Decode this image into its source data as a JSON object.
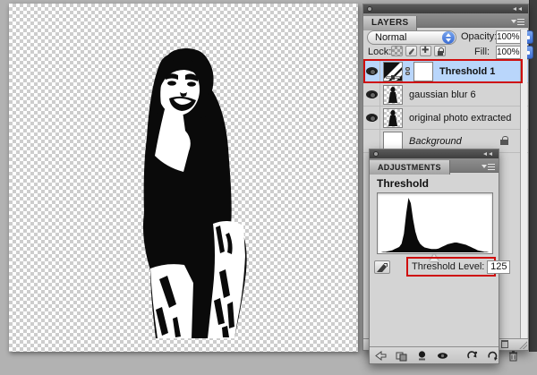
{
  "colors": {
    "background": "#b2b2b2",
    "panel": "#d4d4d4",
    "selected_row": "#b9d6fb",
    "annotation_red": "#cf0e0e",
    "checker_dark": "#cdcdcd",
    "checker_light": "#ffffff"
  },
  "canvas": {
    "description": "black and white threshold silhouette of a girl on transparent checkerboard"
  },
  "layers_panel": {
    "tab": "LAYERS",
    "blend_mode": "Normal",
    "opacity_label": "Opacity:",
    "opacity_value": "100%",
    "lock_label": "Lock:",
    "lock_icons": [
      "lock-transparent-pixels",
      "lock-image-pixels",
      "lock-position",
      "lock-all"
    ],
    "fill_label": "Fill:",
    "fill_value": "100%",
    "layers": [
      {
        "name": "Threshold 1",
        "selected": true,
        "visible": true,
        "type": "threshold-adjustment",
        "red_highlight": true
      },
      {
        "name": "gaussian blur 6",
        "selected": false,
        "visible": true,
        "type": "image"
      },
      {
        "name": "original photo extracted",
        "selected": false,
        "visible": true,
        "type": "image"
      },
      {
        "name": "Background",
        "selected": false,
        "visible": false,
        "type": "background",
        "locked": true
      }
    ]
  },
  "adjustments_panel": {
    "tab": "ADJUSTMENTS",
    "title": "Threshold",
    "threshold_label": "Threshold Level:",
    "threshold_value": "125",
    "slider_position": 0.49,
    "histogram": [
      0,
      0,
      1,
      1,
      2,
      3,
      4,
      6,
      8,
      10,
      16,
      34,
      72,
      100,
      90,
      60,
      38,
      24,
      16,
      12,
      9,
      8,
      7,
      6,
      6,
      6,
      7,
      9,
      11,
      13,
      15,
      16,
      17,
      18,
      18,
      17,
      16,
      15,
      14,
      12,
      10,
      8,
      6,
      4,
      3,
      2,
      1,
      1,
      0,
      0
    ],
    "footer_icons": [
      "return-to-adjustment-list",
      "expanded-view",
      "clip-to-layer",
      "toggle-layer-visibility",
      "view-previous-state",
      "reset-to-defaults",
      "delete-adjustment-layer"
    ]
  }
}
